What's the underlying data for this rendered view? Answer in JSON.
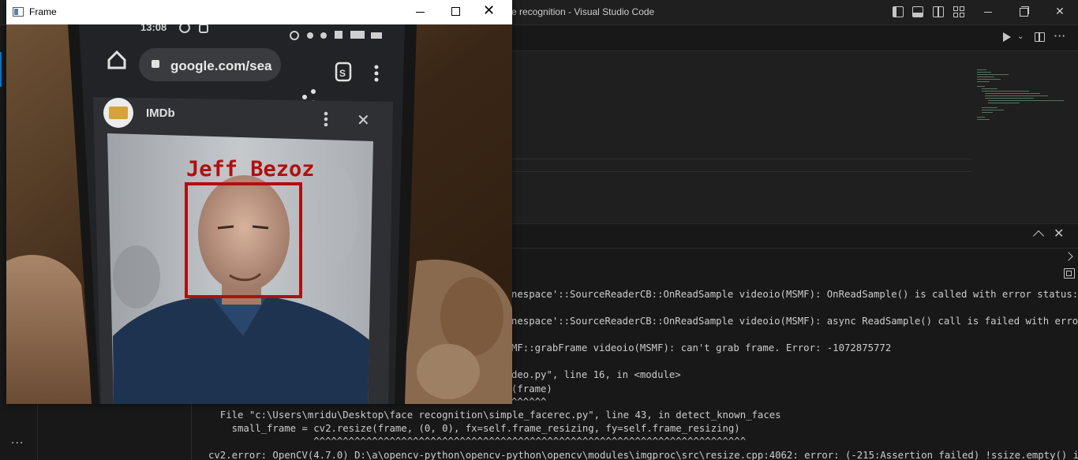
{
  "vscode": {
    "title": "e recognition - Visual Studio Code",
    "icons": {
      "layout": [
        "toggle-primary-sidebar-icon",
        "toggle-panel-icon",
        "toggle-secondary-sidebar-icon",
        "customize-layout-icon"
      ],
      "window": [
        "minimize-icon",
        "restore-icon",
        "close-icon"
      ],
      "editor_actions": [
        "run-icon",
        "chevron-down-icon",
        "split-editor-icon",
        "more-actions-icon"
      ],
      "panel": [
        "chevron-up-icon",
        "close-icon",
        "chevron-right-icon",
        "terminal-icon"
      ]
    },
    "window_close_glyph": "✕",
    "more_glyph": "···",
    "panel_more_glyph": "···",
    "panel_close_glyph": "✕",
    "accent_color": "#0078d4"
  },
  "terminal": {
    "lines": [
      "nespace'::SourceReaderCB::OnReadSample videoio(MSMF): OnReadSample() is called with error status:",
      "nespace'::SourceReaderCB::OnReadSample videoio(MSMF): async ReadSample() call is failed with erro",
      "MF::grabFrame videoio(MSMF): can't grab frame. Error: -1072875772",
      "deo.py\", line 16, in <module>",
      "(frame)",
      "^^^^^^",
      "  File \"c:\\Users\\mridu\\Desktop\\face recognition\\simple_facerec.py\", line 43, in detect_known_faces",
      "    small_frame = cv2.resize(frame, (0, 0), fx=self.frame_resizing, fy=self.frame_resizing)",
      "                  ^^^^^^^^^^^^^^^^^^^^^^^^^^^^^^^^^^^^^^^^^^^^^^^^^^^^^^^^^^^^^^^^^^^^^^^^^^",
      "cv2.error: OpenCV(4.7.0) D:\\a\\opencv-python\\opencv-python\\opencv\\modules\\imgproc\\src\\resize.cpp:4062: error: (-215:Assertion failed) !ssize.empty() in"
    ]
  },
  "frame_window": {
    "title": "Frame",
    "close_glyph": "✕",
    "label": "Jeff Bezoz",
    "label_color": "#b00f0f",
    "phone": {
      "status_time": "13:08",
      "url": "google.com/sea",
      "tab_name": "IMDb",
      "tab_badge": "S",
      "close_glyph": "✕"
    }
  }
}
